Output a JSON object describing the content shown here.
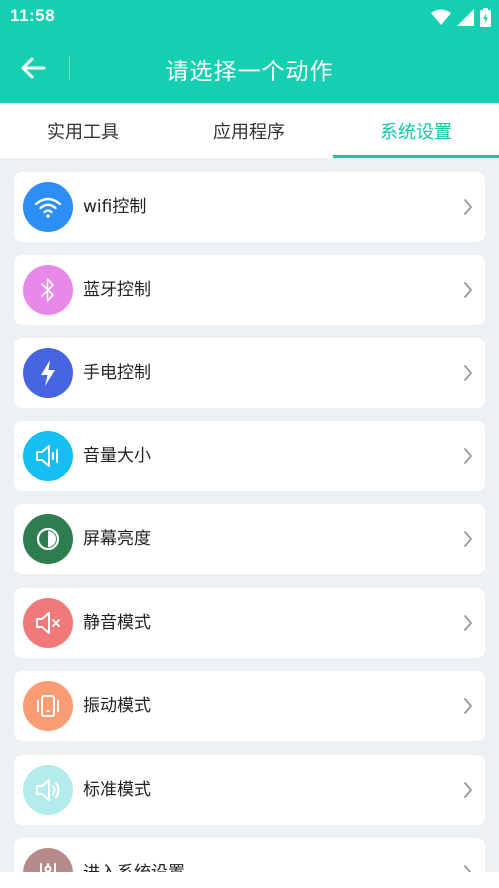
{
  "status": {
    "time": "11:58"
  },
  "header": {
    "title": "请选择一个动作"
  },
  "tabs": [
    {
      "label": "实用工具"
    },
    {
      "label": "应用程序"
    },
    {
      "label": "系统设置"
    }
  ],
  "items": [
    {
      "label": "wifi控制",
      "icon": "wifi-icon",
      "color": "#2d8ef5"
    },
    {
      "label": "蓝牙控制",
      "icon": "bluetooth-icon",
      "color": "#e889e9"
    },
    {
      "label": "手电控制",
      "icon": "flash-icon",
      "color": "#4764e0"
    },
    {
      "label": "音量大小",
      "icon": "volume-icon",
      "color": "#16bff2"
    },
    {
      "label": "屏幕亮度",
      "icon": "brightness-icon",
      "color": "#2e7d4f"
    },
    {
      "label": "静音模式",
      "icon": "mute-icon",
      "color": "#f07a7a"
    },
    {
      "label": "振动模式",
      "icon": "vibrate-icon",
      "color": "#fb9d74"
    },
    {
      "label": "标准模式",
      "icon": "sound-icon",
      "color": "#b4ebeb"
    },
    {
      "label": "进入系统设置",
      "icon": "settings-sliders-icon",
      "color": "#b58a88"
    }
  ]
}
